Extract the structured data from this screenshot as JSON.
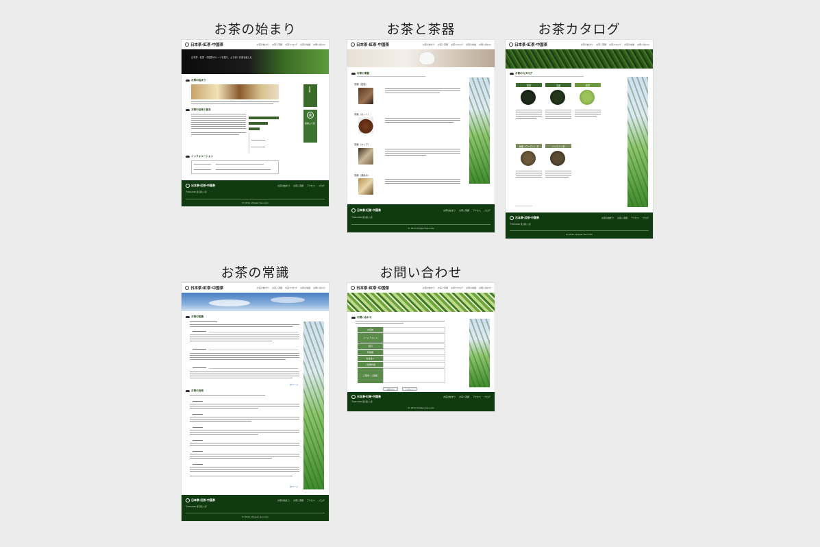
{
  "site": {
    "logo": "日本茶·紅茶·中国茶",
    "nav": [
      "お茶の始まり",
      "お茶と茶器",
      "お茶カタログ",
      "お茶の常識",
      "お問い合わせ"
    ],
    "footer_nav": [
      "お茶の始まり",
      "お茶と茶器",
      "アクセス",
      "ブログ"
    ],
    "footer_copy": "(C) 2011 All Japan tea union",
    "footer_address": "〒000-0000 東京都○○区"
  },
  "cards": [
    {
      "title": "お茶の始まり"
    },
    {
      "title": "お茶と茶器"
    },
    {
      "title": "お茶カタログ"
    },
    {
      "title": "お茶の常識"
    },
    {
      "title": "お問い合わせ"
    }
  ],
  "page1": {
    "hero_text": "日本茶・紅茶・中国茶のルーツを知り、より深くお茶を楽しむ",
    "sections": [
      "お茶の始まり",
      "お茶の伝来と普及",
      "インフォメーション"
    ],
    "banner_top": "日本茶",
    "banner_bottom": "和紙入り缶"
  },
  "page2": {
    "sections": [
      "お茶と茶器",
      "茶器（急須）",
      "茶器（ポット）",
      "茶器（カップ）",
      "茶器（湯呑み）"
    ]
  },
  "page3": {
    "section": "お茶のカタログ",
    "labels": [
      "煎茶",
      "玉露",
      "抹茶",
      "烏龍（ウーロン）茶",
      "ジャスミン茶"
    ]
  },
  "page4": {
    "sections": [
      "お茶の知識",
      "お茶の効用"
    ],
    "more": "次ページ"
  },
  "page5": {
    "section": "お問い合わせ",
    "fields": [
      "お名前",
      "メールアドレス",
      "性別",
      "年齢層",
      "お住まい",
      "ご質問内容",
      "ご意見・ご感想"
    ],
    "buttons": [
      "送信する",
      "リセット"
    ]
  },
  "colors": {
    "dark_green": "#103a0f",
    "accent_green": "#3c6b2d",
    "background": "#ececec"
  }
}
